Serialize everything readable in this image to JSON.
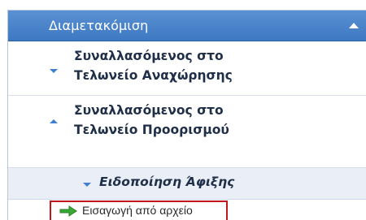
{
  "menu": {
    "header_title": "Διαμετακόμιση",
    "items": [
      {
        "line1": "Συναλλασόμενος στο",
        "line2": "Τελωνείο Αναχώρησης"
      },
      {
        "line1": "Συναλλασόμενος στο",
        "line2": "Τελωνείο Προορισμού"
      }
    ],
    "subitem": {
      "label": "Ειδοποίηση Άφιξης"
    },
    "leaf": {
      "label": "Εισαγωγή από αρχείο"
    }
  },
  "colors": {
    "header_blue": "#3d78c2",
    "triangle_blue": "#3f7fcf",
    "subitem_bg": "#e9eef7",
    "highlight_red": "#c0181d",
    "arrow_green": "#39a935"
  },
  "icons": {
    "header": "chevron-up-icon",
    "item_collapsed": "triangle-down-icon",
    "item_expanded": "triangle-up-icon",
    "leaf": "green-arrow-right-icon"
  }
}
